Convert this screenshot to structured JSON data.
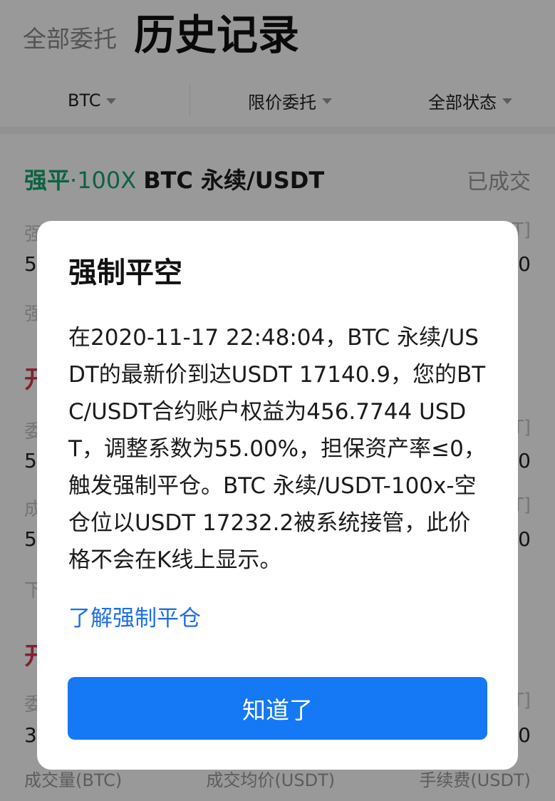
{
  "header": {
    "tab_all_orders": "全部委托",
    "tab_history": "历史记录"
  },
  "filters": {
    "coin": "BTC",
    "order_type": "限价委托",
    "status": "全部状态"
  },
  "order": {
    "tag": "强平",
    "leverage": "·100X",
    "pair": "BTC 永续/USDT",
    "status": "已成交"
  },
  "background_peek": {
    "r1_left": "强",
    "r1_right": "T]",
    "r2_left": "5.",
    "r2_right": "00",
    "r3_left": "强",
    "r4_left": "开",
    "r5_left": "委",
    "r5_right": "T]",
    "r6_left": "5.",
    "r6_right": "00",
    "r7_left": "成",
    "r7_right": "T]",
    "r8_left": "5.",
    "r8_right": "00",
    "r9_left": "下",
    "r10_left": "开",
    "r11_left": "委",
    "r11_right": "T]",
    "r12_left": "3.",
    "r12_right": "00"
  },
  "footer_row": {
    "col1": "成交量(BTC)",
    "col2": "成交均价(USDT)",
    "col3": "手续费(USDT)"
  },
  "dialog": {
    "title": "强制平空",
    "body": "在2020-11-17 22:48:04，BTC 永续/USDT的最新价到达USDT 17140.9，您的BTC/USDT合约账户权益为456.7744 USDT，调整系数为55.00%，担保资产率≤0，触发强制平仓。BTC 永续/USDT-100x-空 仓位以USDT 17232.2被系统接管，此价格不会在K线上显示。",
    "link": "了解强制平仓",
    "button": "知道了"
  }
}
